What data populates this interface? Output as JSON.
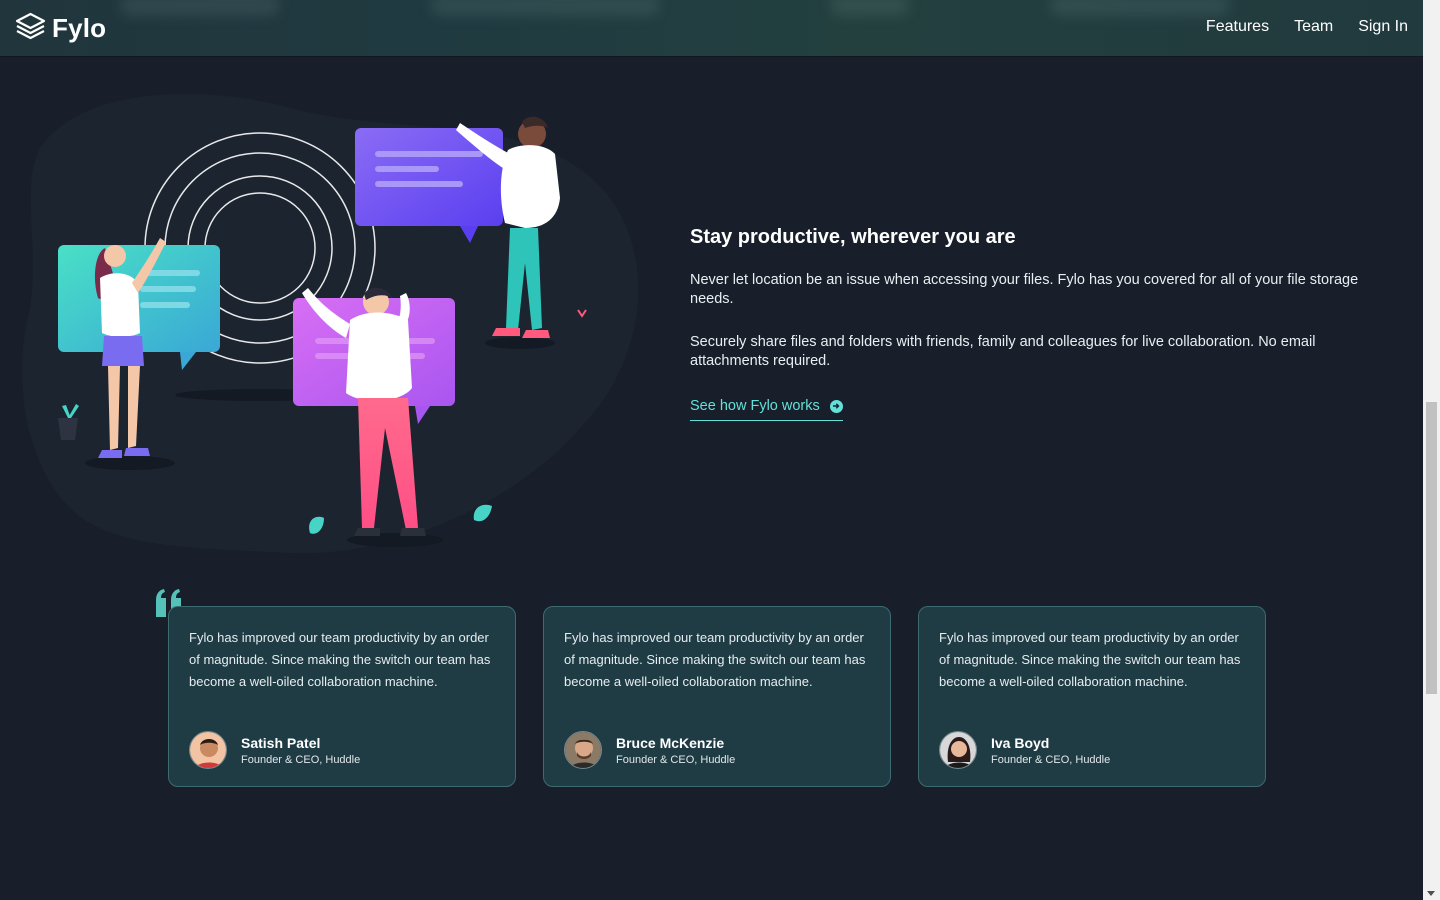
{
  "header": {
    "logo_text": "Fylo",
    "logo_icon": "layers-icon",
    "nav": [
      "Features",
      "Team",
      "Sign In"
    ]
  },
  "productive": {
    "title": "Stay productive, wherever you are",
    "paragraph1": "Never let location be an issue when accessing your files. Fylo has you covered for all of your file storage needs.",
    "paragraph2": "Securely share files and folders with friends, family and colleagues for live collaboration. No email attachments required.",
    "link_label": "See how Fylo works",
    "link_icon": "arrow-right-circle-icon"
  },
  "testimonials": [
    {
      "quote": "Fylo has improved our team productivity by an order of magnitude. Since making the switch our team has become a well-oiled collaboration machine.",
      "name": "Satish Patel",
      "role": "Founder & CEO, Huddle"
    },
    {
      "quote": "Fylo has improved our team productivity by an order of magnitude. Since making the switch our team has become a well-oiled collaboration machine.",
      "name": "Bruce McKenzie",
      "role": "Founder & CEO, Huddle"
    },
    {
      "quote": "Fylo has improved our team productivity by an order of magnitude. Since making the switch our team has become a well-oiled collaboration machine.",
      "name": "Iva Boyd",
      "role": "Founder & CEO, Huddle"
    }
  ],
  "colors": {
    "background": "#181f2a",
    "header": "#213a3e",
    "accent": "#62e0d9",
    "card": "#1f3c44",
    "card_border": "#3d6b70"
  }
}
